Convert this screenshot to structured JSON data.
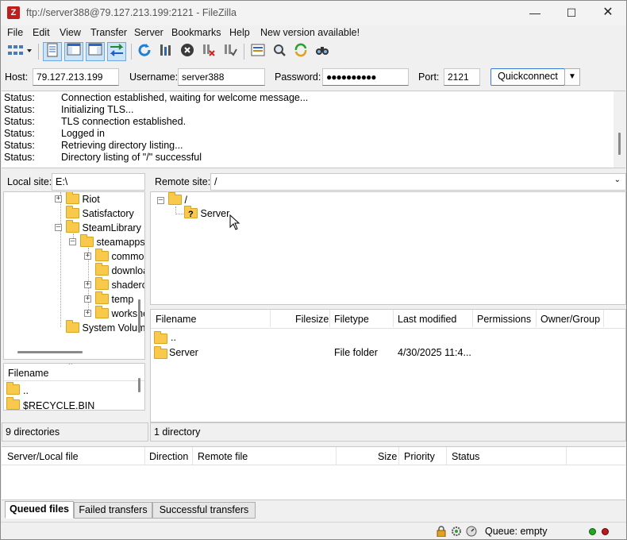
{
  "window": {
    "title": "ftp://server388@79.127.213.199:2121 - FileZilla",
    "app_icon": "filezilla-icon"
  },
  "menu": [
    "File",
    "Edit",
    "View",
    "Transfer",
    "Server",
    "Bookmarks",
    "Help",
    "New version available!"
  ],
  "quickconnect": {
    "host_label": "Host:",
    "host_value": "79.127.213.199",
    "username_label": "Username:",
    "username_value": "server388",
    "password_label": "Password:",
    "password_value": "●●●●●●●●●●",
    "port_label": "Port:",
    "port_value": "2121",
    "button_label": "Quickconnect"
  },
  "log": [
    {
      "k": "Status:",
      "v": "Connection established, waiting for welcome message..."
    },
    {
      "k": "Status:",
      "v": "Initializing TLS..."
    },
    {
      "k": "Status:",
      "v": "TLS connection established."
    },
    {
      "k": "Status:",
      "v": "Logged in"
    },
    {
      "k": "Status:",
      "v": "Retrieving directory listing..."
    },
    {
      "k": "Status:",
      "v": "Directory listing of \"/\" successful"
    }
  ],
  "local": {
    "site_label": "Local site:",
    "site_value": "E:\\",
    "tree": [
      "Riot",
      "Satisfactory",
      "SteamLibrary",
      "steamapps",
      "common",
      "downloading",
      "shadercache",
      "temp",
      "workshop",
      "System Volume Information"
    ],
    "file_header": "Filename",
    "files": [
      "..",
      "$RECYCLE.BIN"
    ],
    "status": "9 directories"
  },
  "remote": {
    "site_label": "Remote site:",
    "site_value": "/",
    "tree_root": "/",
    "tree_child": "Server",
    "headers": [
      "Filename",
      "Filesize",
      "Filetype",
      "Last modified",
      "Permissions",
      "Owner/Group"
    ],
    "files": [
      {
        "name": "..",
        "size": "",
        "type": "",
        "modified": ""
      },
      {
        "name": "Server",
        "size": "",
        "type": "File folder",
        "modified": "4/30/2025 11:4..."
      }
    ],
    "status": "1 directory"
  },
  "queue": {
    "headers": [
      "Server/Local file",
      "Direction",
      "Remote file",
      "Size",
      "Priority",
      "Status"
    ],
    "tabs": [
      "Queued files",
      "Failed transfers",
      "Successful transfers"
    ],
    "status_text": "Queue: empty"
  }
}
